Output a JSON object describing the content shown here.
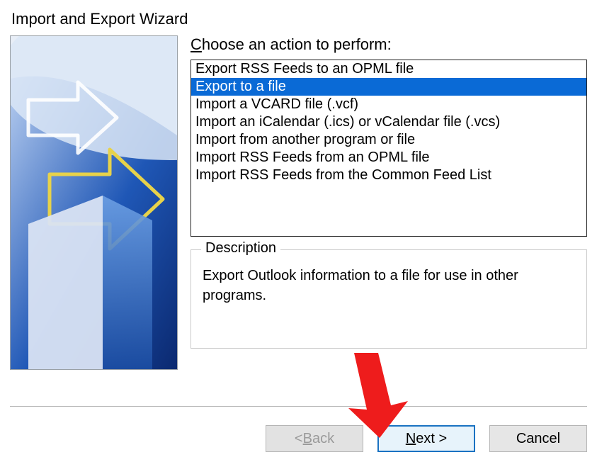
{
  "window": {
    "title": "Import and Export Wizard"
  },
  "main": {
    "choose_label_pre": "C",
    "choose_label_post": "hoose an action to perform:",
    "options": [
      "Export RSS Feeds to an OPML file",
      "Export to a file",
      "Import a VCARD file (.vcf)",
      "Import an iCalendar (.ics) or vCalendar file (.vcs)",
      "Import from another program or file",
      "Import RSS Feeds from an OPML file",
      "Import RSS Feeds from the Common Feed List"
    ],
    "selected_index": 1
  },
  "description": {
    "legend": "Description",
    "text": "Export Outlook information to a file for use in other programs."
  },
  "buttons": {
    "back_pre": "< ",
    "back_ul": "B",
    "back_post": "ack",
    "next_ul": "N",
    "next_post": "ext >",
    "cancel": "Cancel"
  },
  "colors": {
    "selection": "#0a6ad6",
    "primary_border": "#1a72c2",
    "annotation_arrow": "#ee1c1c"
  }
}
